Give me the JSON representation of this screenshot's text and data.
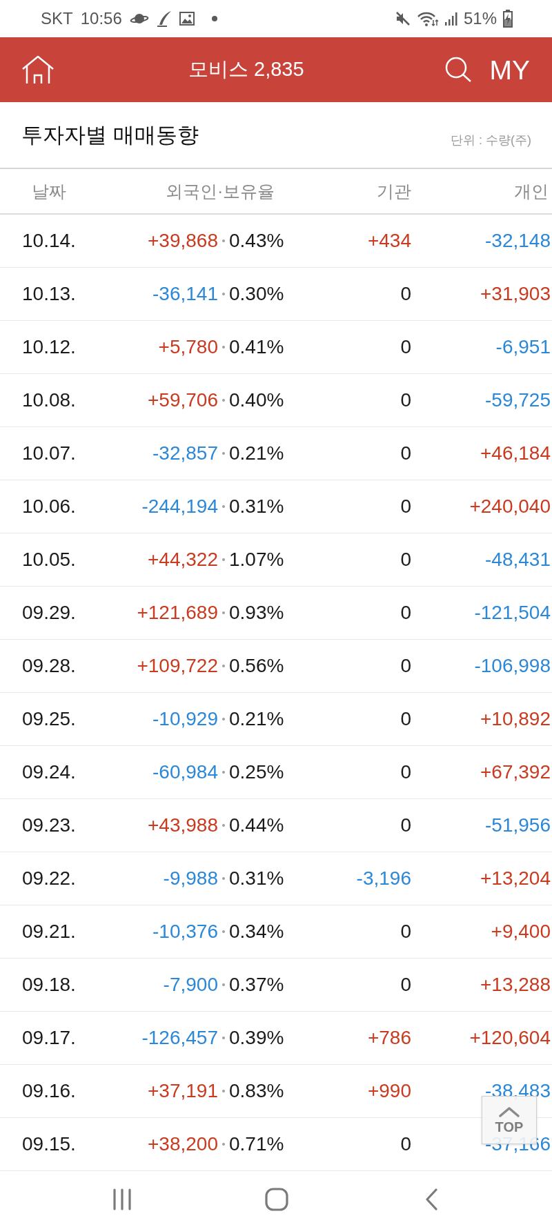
{
  "status_bar": {
    "carrier": "SKT",
    "time": "10:56",
    "battery": "51%"
  },
  "header": {
    "title": "모비스 2,835",
    "my_label": "MY"
  },
  "section": {
    "title": "투자자별 매매동향",
    "unit": "단위 : 수량(주)"
  },
  "table": {
    "columns": [
      "날짜",
      "외국인·보유율",
      "기관",
      "개인"
    ],
    "rows": [
      {
        "date": "10.14.",
        "foreign": {
          "text": "+39,868",
          "color": "#c93a1f"
        },
        "holding_rate": "0.43%",
        "institution": {
          "text": "+434",
          "color": "#c93a1f"
        },
        "individual": {
          "text": "-32,148",
          "color": "#2b87d8"
        }
      },
      {
        "date": "10.13.",
        "foreign": {
          "text": "-36,141",
          "color": "#2b87d8"
        },
        "holding_rate": "0.30%",
        "institution": {
          "text": "0",
          "color": "#1a1a1a"
        },
        "individual": {
          "text": "+31,903",
          "color": "#c93a1f"
        }
      },
      {
        "date": "10.12.",
        "foreign": {
          "text": "+5,780",
          "color": "#c93a1f"
        },
        "holding_rate": "0.41%",
        "institution": {
          "text": "0",
          "color": "#1a1a1a"
        },
        "individual": {
          "text": "-6,951",
          "color": "#2b87d8"
        }
      },
      {
        "date": "10.08.",
        "foreign": {
          "text": "+59,706",
          "color": "#c93a1f"
        },
        "holding_rate": "0.40%",
        "institution": {
          "text": "0",
          "color": "#1a1a1a"
        },
        "individual": {
          "text": "-59,725",
          "color": "#2b87d8"
        }
      },
      {
        "date": "10.07.",
        "foreign": {
          "text": "-32,857",
          "color": "#2b87d8"
        },
        "holding_rate": "0.21%",
        "institution": {
          "text": "0",
          "color": "#1a1a1a"
        },
        "individual": {
          "text": "+46,184",
          "color": "#c93a1f"
        }
      },
      {
        "date": "10.06.",
        "foreign": {
          "text": "-244,194",
          "color": "#2b87d8"
        },
        "holding_rate": "0.31%",
        "institution": {
          "text": "0",
          "color": "#1a1a1a"
        },
        "individual": {
          "text": "+240,040",
          "color": "#c93a1f"
        }
      },
      {
        "date": "10.05.",
        "foreign": {
          "text": "+44,322",
          "color": "#c93a1f"
        },
        "holding_rate": "1.07%",
        "institution": {
          "text": "0",
          "color": "#1a1a1a"
        },
        "individual": {
          "text": "-48,431",
          "color": "#2b87d8"
        }
      },
      {
        "date": "09.29.",
        "foreign": {
          "text": "+121,689",
          "color": "#c93a1f"
        },
        "holding_rate": "0.93%",
        "institution": {
          "text": "0",
          "color": "#1a1a1a"
        },
        "individual": {
          "text": "-121,504",
          "color": "#2b87d8"
        }
      },
      {
        "date": "09.28.",
        "foreign": {
          "text": "+109,722",
          "color": "#c93a1f"
        },
        "holding_rate": "0.56%",
        "institution": {
          "text": "0",
          "color": "#1a1a1a"
        },
        "individual": {
          "text": "-106,998",
          "color": "#2b87d8"
        }
      },
      {
        "date": "09.25.",
        "foreign": {
          "text": "-10,929",
          "color": "#2b87d8"
        },
        "holding_rate": "0.21%",
        "institution": {
          "text": "0",
          "color": "#1a1a1a"
        },
        "individual": {
          "text": "+10,892",
          "color": "#c93a1f"
        }
      },
      {
        "date": "09.24.",
        "foreign": {
          "text": "-60,984",
          "color": "#2b87d8"
        },
        "holding_rate": "0.25%",
        "institution": {
          "text": "0",
          "color": "#1a1a1a"
        },
        "individual": {
          "text": "+67,392",
          "color": "#c93a1f"
        }
      },
      {
        "date": "09.23.",
        "foreign": {
          "text": "+43,988",
          "color": "#c93a1f"
        },
        "holding_rate": "0.44%",
        "institution": {
          "text": "0",
          "color": "#1a1a1a"
        },
        "individual": {
          "text": "-51,956",
          "color": "#2b87d8"
        }
      },
      {
        "date": "09.22.",
        "foreign": {
          "text": "-9,988",
          "color": "#2b87d8"
        },
        "holding_rate": "0.31%",
        "institution": {
          "text": "-3,196",
          "color": "#2b87d8"
        },
        "individual": {
          "text": "+13,204",
          "color": "#c93a1f"
        }
      },
      {
        "date": "09.21.",
        "foreign": {
          "text": "-10,376",
          "color": "#2b87d8"
        },
        "holding_rate": "0.34%",
        "institution": {
          "text": "0",
          "color": "#1a1a1a"
        },
        "individual": {
          "text": "+9,400",
          "color": "#c93a1f"
        }
      },
      {
        "date": "09.18.",
        "foreign": {
          "text": "-7,900",
          "color": "#2b87d8"
        },
        "holding_rate": "0.37%",
        "institution": {
          "text": "0",
          "color": "#1a1a1a"
        },
        "individual": {
          "text": "+13,288",
          "color": "#c93a1f"
        }
      },
      {
        "date": "09.17.",
        "foreign": {
          "text": "-126,457",
          "color": "#2b87d8"
        },
        "holding_rate": "0.39%",
        "institution": {
          "text": "+786",
          "color": "#c93a1f"
        },
        "individual": {
          "text": "+120,604",
          "color": "#c93a1f"
        }
      },
      {
        "date": "09.16.",
        "foreign": {
          "text": "+37,191",
          "color": "#c93a1f"
        },
        "holding_rate": "0.83%",
        "institution": {
          "text": "+990",
          "color": "#c93a1f"
        },
        "individual": {
          "text": "-38,483",
          "color": "#2b87d8"
        }
      },
      {
        "date": "09.15.",
        "foreign": {
          "text": "+38,200",
          "color": "#c93a1f"
        },
        "holding_rate": "0.71%",
        "institution": {
          "text": "0",
          "color": "#1a1a1a"
        },
        "individual": {
          "text": "-37,166",
          "color": "#2b87d8"
        }
      }
    ]
  },
  "top_button": {
    "label": "TOP"
  }
}
